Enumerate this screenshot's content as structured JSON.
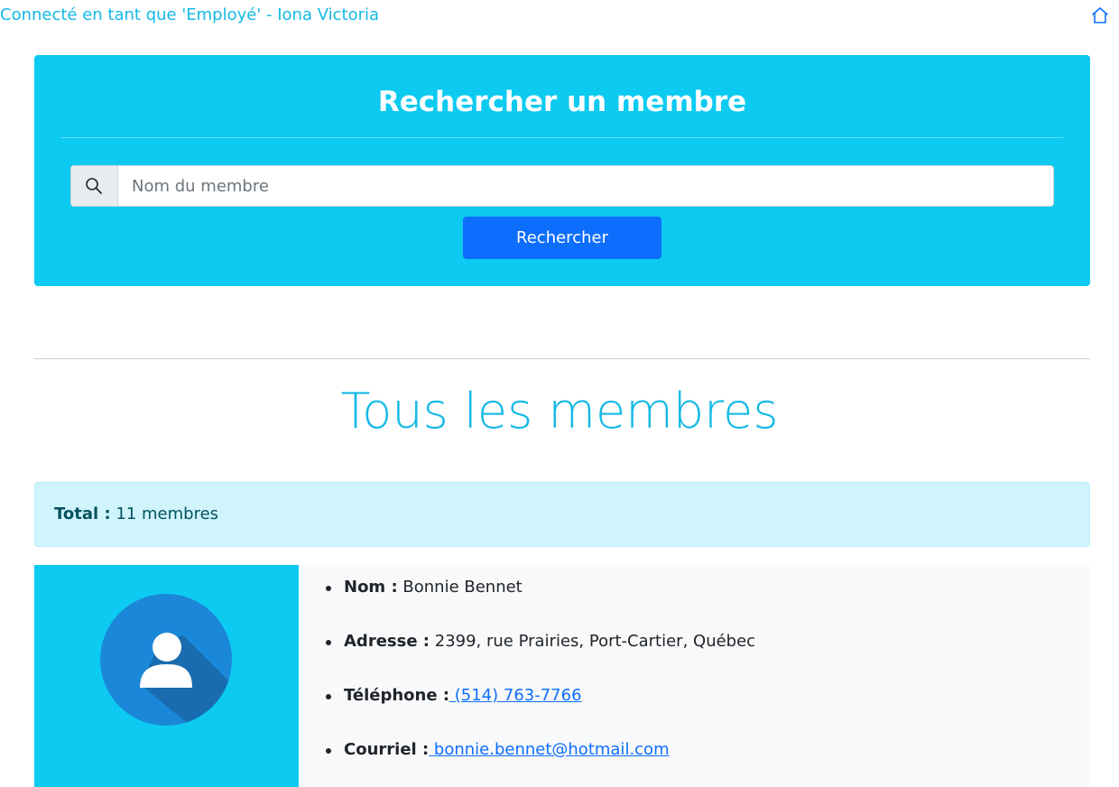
{
  "header": {
    "login_text": "Connecté en tant que 'Employé' - Iona Victoria",
    "home_icon": "home-icon"
  },
  "search": {
    "title": "Rechercher un membre",
    "placeholder": "Nom du membre",
    "value": "",
    "button_label": "Rechercher",
    "icon": "search-icon"
  },
  "members": {
    "title": "Tous les membres",
    "total_label": "Total :",
    "total_value": "11 membres",
    "list": [
      {
        "avatar_icon": "user-avatar-icon",
        "name_label": "Nom :",
        "name": "Bonnie Bennet",
        "address_label": "Adresse :",
        "address": "2399, rue Prairies, Port-Cartier, Québec",
        "phone_label": "Téléphone :",
        "phone": " (514) 763-7766",
        "email_label": "Courriel :",
        "email": " bonnie.bennet@hotmail.com"
      }
    ]
  },
  "colors": {
    "primary": "#0dcaf0",
    "accent": "#13b9e6",
    "button": "#0d6efd",
    "link": "#0d6efd",
    "info_bg": "#cff4fc",
    "info_text": "#055160"
  }
}
